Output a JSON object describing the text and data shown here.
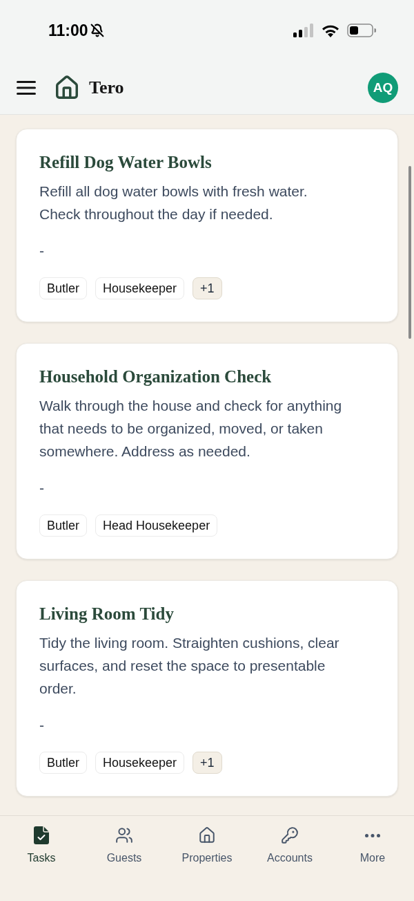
{
  "status_bar": {
    "time": "11:00"
  },
  "header": {
    "title": "Tero",
    "avatar": "AQ"
  },
  "tasks": [
    {
      "title": "Refill Dog Water Bowls",
      "description": "Refill all dog water bowls with fresh water. Check throughout the day if needed.",
      "detail": "-",
      "tags": [
        {
          "label": "Butler",
          "kind": "role"
        },
        {
          "label": "Housekeeper",
          "kind": "role"
        },
        {
          "label": "+1",
          "kind": "more"
        }
      ]
    },
    {
      "title": "Household Organization Check",
      "description": "Walk through the house and check for anything that needs to be organized, moved, or taken somewhere. Address as needed.",
      "detail": "-",
      "tags": [
        {
          "label": "Butler",
          "kind": "role"
        },
        {
          "label": "Head Housekeeper",
          "kind": "role"
        }
      ]
    },
    {
      "title": "Living Room Tidy",
      "description": "Tidy the living room. Straighten cushions, clear surfaces, and reset the space to presentable order.",
      "detail": "-",
      "tags": [
        {
          "label": "Butler",
          "kind": "role"
        },
        {
          "label": "Housekeeper",
          "kind": "role"
        },
        {
          "label": "+1",
          "kind": "more"
        }
      ]
    }
  ],
  "nav": [
    {
      "label": "Tasks",
      "selected": true
    },
    {
      "label": "Guests",
      "selected": false
    },
    {
      "label": "Properties",
      "selected": false
    },
    {
      "label": "Accounts",
      "selected": false
    },
    {
      "label": "More",
      "selected": false
    }
  ]
}
